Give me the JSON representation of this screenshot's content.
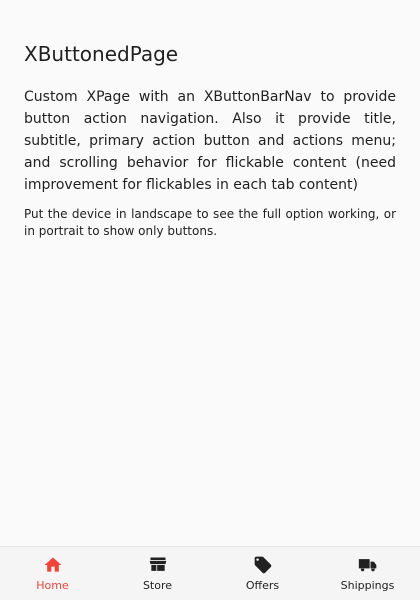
{
  "page": {
    "title": "XButtonedPage",
    "description": "Custom XPage with an XButtonBarNav to provide button action navigation. Also it provide title, subtitle, primary action button and actions menu; and scrolling behavior for flickable content (need improvement for flickables in each tab content)",
    "note": "Put the device in landscape to see the full option working, or in portrait to show only buttons."
  },
  "bottom_nav": {
    "active_color": "#f44336",
    "inactive_color": "#212121",
    "items": [
      {
        "label": "Home",
        "icon": "home-icon",
        "active": true
      },
      {
        "label": "Store",
        "icon": "store-icon",
        "active": false
      },
      {
        "label": "Offers",
        "icon": "tag-icon",
        "active": false
      },
      {
        "label": "Shippings",
        "icon": "truck-icon",
        "active": false
      }
    ]
  }
}
